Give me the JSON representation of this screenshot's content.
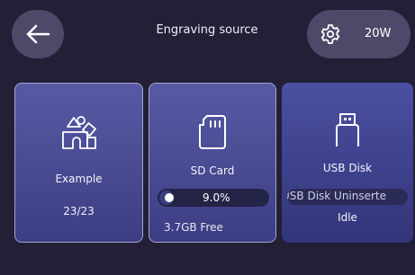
{
  "header": {
    "title": "Engraving source",
    "power": "20W"
  },
  "cards": {
    "example": {
      "label": "Example",
      "count": "23/23"
    },
    "sd_card": {
      "label": "SD Card",
      "usage_percent": "9.0%",
      "usage_fraction": 0.09,
      "free_space": "3.7GB Free"
    },
    "usb_disk": {
      "label": "USB Disk",
      "status": "USB Disk Uninserte",
      "state": "Idle"
    }
  },
  "colors": {
    "background": "#221f37",
    "pill_button": "#4d4968",
    "card_top": "#575aa3",
    "card_bottom": "#3d3d84"
  }
}
